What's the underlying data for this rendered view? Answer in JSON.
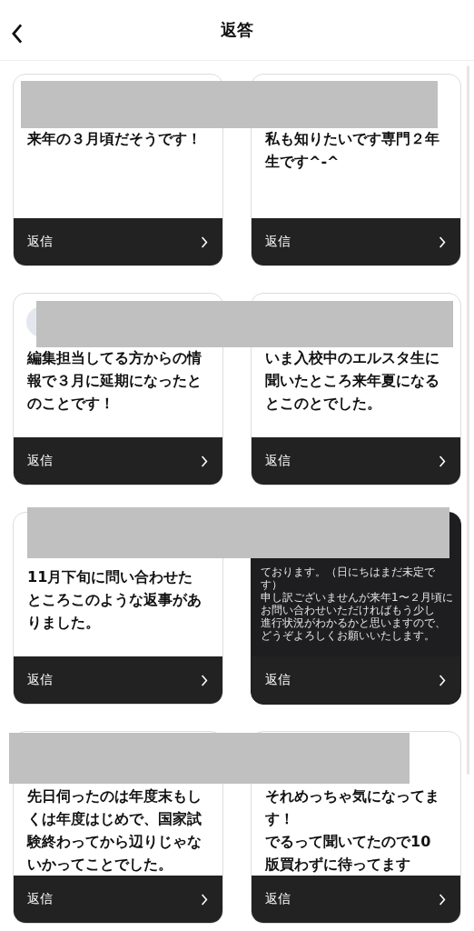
{
  "header": {
    "title": "返答"
  },
  "cards": [
    {
      "kind": "text",
      "avatar": false,
      "paragraphs": [
        "来年の３月頃だそうです！"
      ],
      "action": "返信"
    },
    {
      "kind": "text",
      "avatar": false,
      "paragraphs": [
        "私も知りたいです専門２年生です^-^"
      ],
      "action": "返信"
    },
    {
      "kind": "text",
      "avatar": true,
      "paragraphs": [
        "編集担当してる方からの情報で３月に延期になったとのことです！"
      ],
      "action": "返信"
    },
    {
      "kind": "text",
      "avatar": false,
      "paragraphs": [
        "いま入校中のエルスタ生に聞いたところ来年夏になるとこのとでした。"
      ],
      "action": "返信"
    },
    {
      "kind": "text",
      "avatar": false,
      "paragraphs": [
        "11月下旬に問い合わせたところこのような返事がありました。"
      ],
      "action": "返信"
    },
    {
      "kind": "screenshot",
      "avatar": false,
      "lines": [
        "ております。（日にちはまだ未定です）",
        "申し訳ございませんが来年1〜２月頃にお問い合わせいただければもう少し",
        "進行状況がわかるかと思いますので、どうぞよろしくお願いいたします。"
      ],
      "action": "返信"
    },
    {
      "kind": "text",
      "avatar": false,
      "paragraphs": [
        "先日伺ったのは年度末もしくは年度はじめで、国家試験終わってから辺りじゃないかってことでした。"
      ],
      "action": "返信"
    },
    {
      "kind": "text",
      "avatar": false,
      "paragraphs": [
        "それめっちゃ気になってます！",
        "でるって聞いてたので10版買わずに待ってます"
      ],
      "action": "返信"
    }
  ]
}
